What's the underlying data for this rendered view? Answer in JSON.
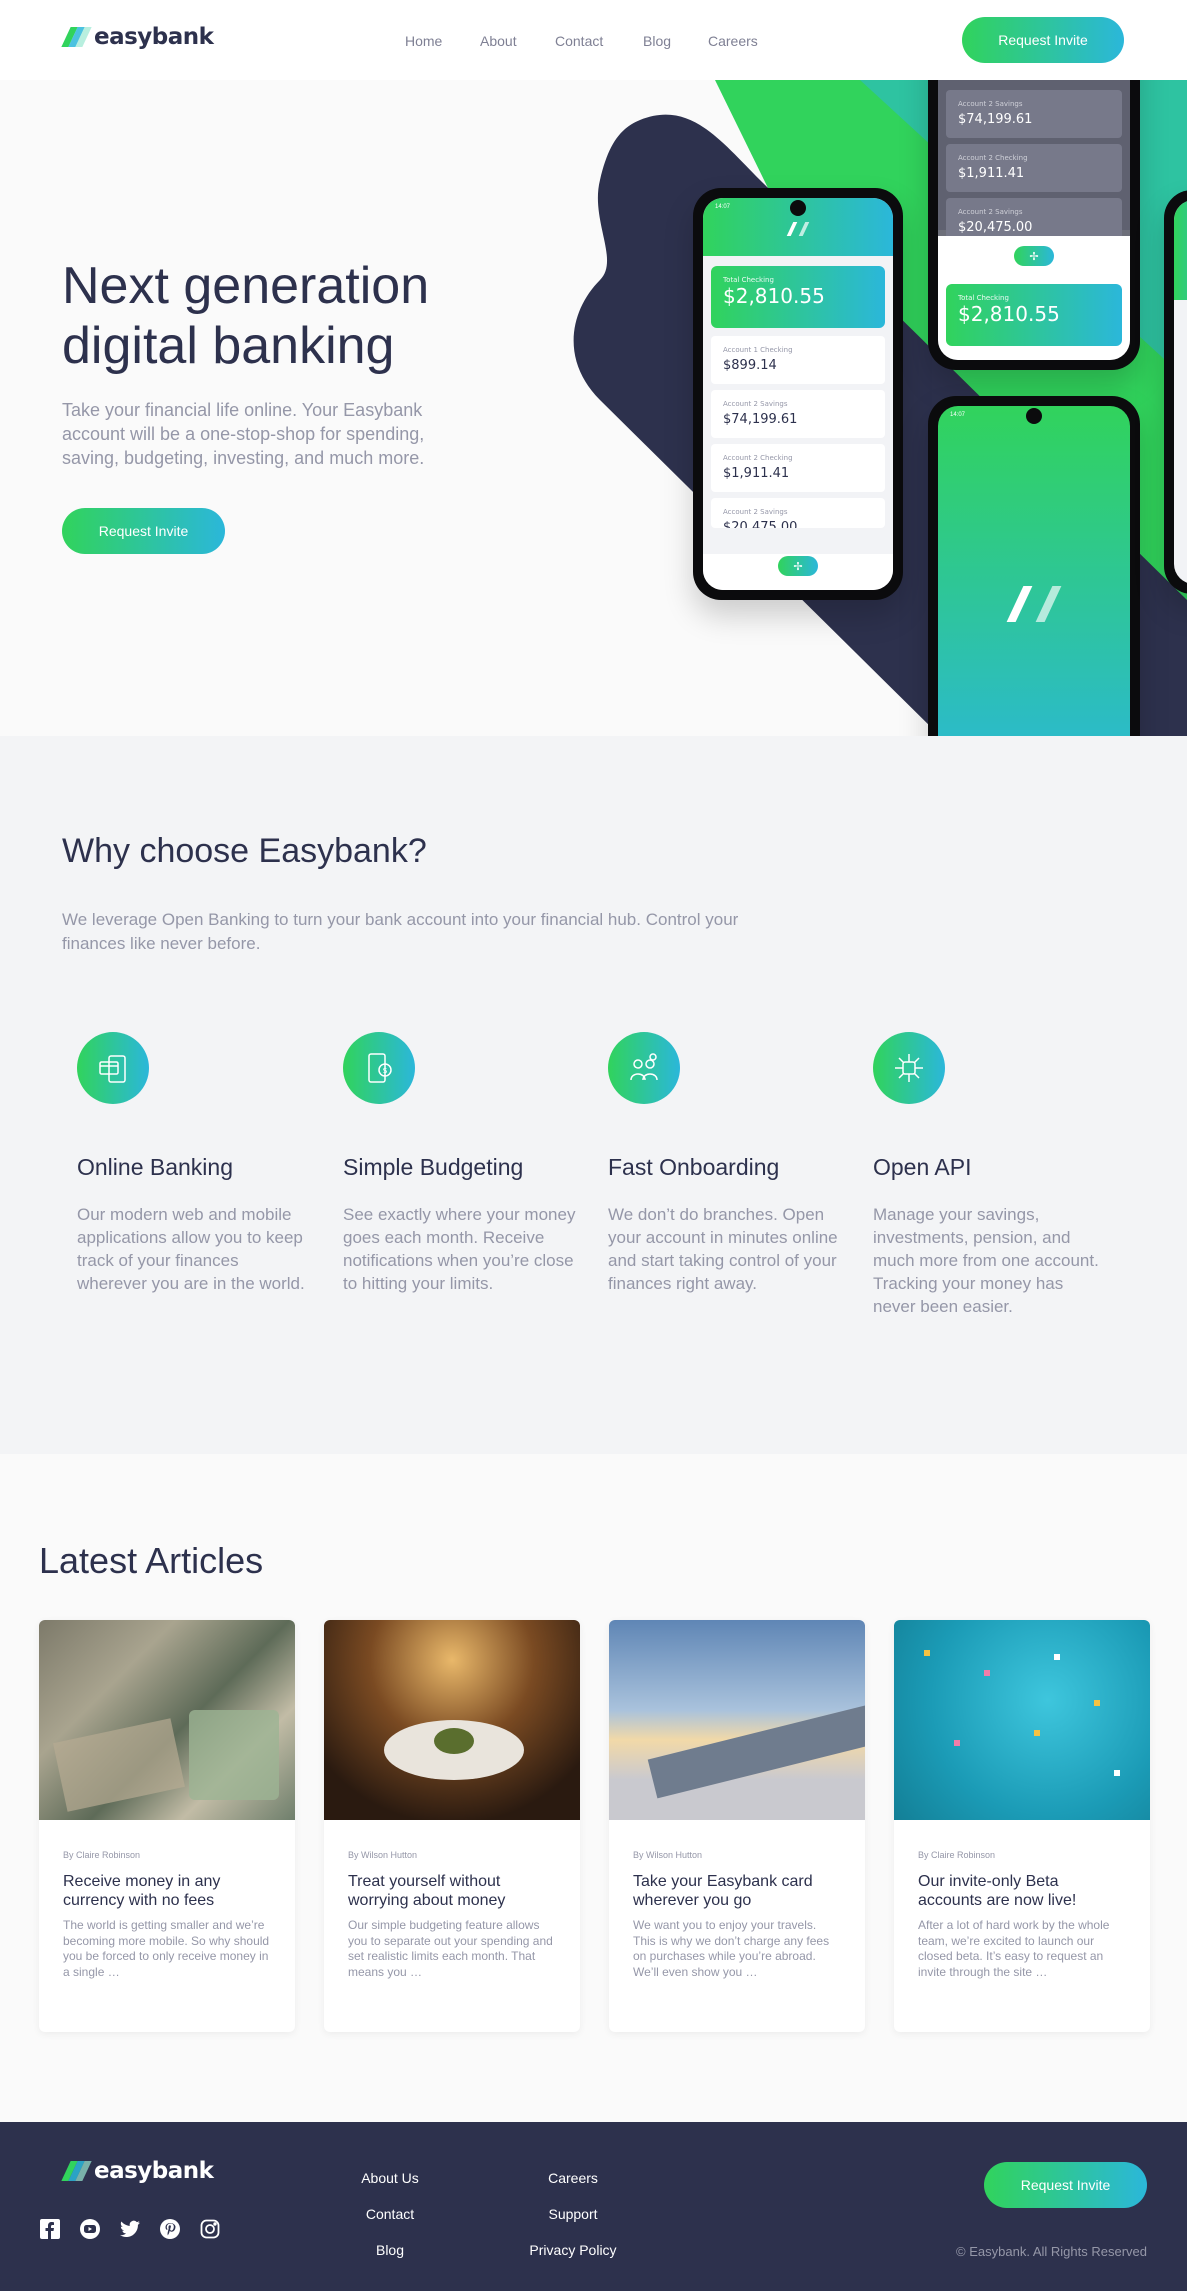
{
  "brand": {
    "name": "easybank"
  },
  "nav": {
    "items": [
      "Home",
      "About",
      "Contact",
      "Blog",
      "Careers"
    ],
    "cta": "Request Invite"
  },
  "hero": {
    "title": "Next generation digital banking",
    "description": "Take your financial life online. Your Easybank account will be a one-stop-shop for spending, saving, budgeting, investing, and much more.",
    "cta": "Request Invite",
    "mockup": {
      "total_label": "Total Checking",
      "total_value": "$2,810.55",
      "accounts": [
        {
          "label": "Account 1 Checking",
          "value": "$899.14"
        },
        {
          "label": "Account 2 Savings",
          "value": "$74,199.61"
        },
        {
          "label": "Account 2 Checking",
          "value": "$1,911.41"
        },
        {
          "label": "Account 2 Savings",
          "value": "$20,475.00"
        }
      ],
      "status_time": "14:07"
    }
  },
  "why": {
    "title": "Why choose Easybank?",
    "description": "We leverage Open Banking to turn your bank account into your financial hub. Control your finances like never before.",
    "features": [
      {
        "icon": "online-banking-icon",
        "title": "Online Banking",
        "text": "Our modern web and mobile applications allow you to keep track of your finances wherever you are in the world."
      },
      {
        "icon": "budgeting-icon",
        "title": "Simple Budgeting",
        "text": "See exactly where your money goes each month. Receive notifications when you’re close to hitting your limits."
      },
      {
        "icon": "onboarding-icon",
        "title": "Fast Onboarding",
        "text": "We don’t do branches. Open your account in minutes online and start taking control of your finances right away."
      },
      {
        "icon": "api-icon",
        "title": "Open API",
        "text": "Manage your savings, investments, pension, and much more from one account. Tracking your money has never been easier."
      }
    ]
  },
  "articles": {
    "title": "Latest Articles",
    "items": [
      {
        "author": "By Claire Robinson",
        "title": "Receive money in any currency with no fees",
        "excerpt": "The world is getting smaller and we’re becoming more mobile. So why should you be forced to only receive money in a single …"
      },
      {
        "author": "By Wilson Hutton",
        "title": "Treat yourself without worrying about money",
        "excerpt": "Our simple budgeting feature allows you to separate out your spending and set realistic limits each month. That means you …"
      },
      {
        "author": "By Wilson Hutton",
        "title": "Take your Easybank card wherever you go",
        "excerpt": "We want you to enjoy your travels. This is why we don’t charge any fees on purchases while you’re abroad. We’ll even show you …"
      },
      {
        "author": "By Claire Robinson",
        "title": "Our invite-only Beta accounts are now live!",
        "excerpt": "After a lot of hard work by the whole team, we’re excited to launch our closed beta. It’s easy to request an invite through the site …"
      }
    ]
  },
  "footer": {
    "links_col1": [
      "About Us",
      "Contact",
      "Blog"
    ],
    "links_col2": [
      "Careers",
      "Support",
      "Privacy Policy"
    ],
    "cta": "Request Invite",
    "copyright": "© Easybank. All Rights Reserved",
    "social": [
      "facebook-icon",
      "youtube-icon",
      "twitter-icon",
      "pinterest-icon",
      "instagram-icon"
    ]
  },
  "colors": {
    "navy": "#2d314d",
    "green": "#31d35c",
    "cyan": "#2bb7da",
    "gray": "#9597a8",
    "light": "#f3f4f6"
  }
}
